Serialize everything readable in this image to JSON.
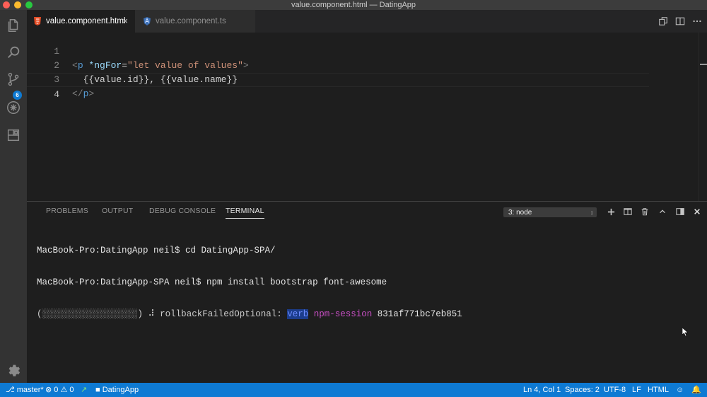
{
  "window": {
    "title": "value.component.html — DatingApp"
  },
  "activity": {
    "scm_badge": "6"
  },
  "tabs": [
    {
      "label": "value.component.html",
      "close": "×"
    },
    {
      "label": "value.component.ts"
    }
  ],
  "editor": {
    "line_numbers": [
      "1",
      "2",
      "3",
      "4"
    ],
    "lines": {
      "l1_open": "<",
      "l1_tag": "p",
      "l1_attr": " *ngFor",
      "l1_eq": "=",
      "l1_str": "\"let value of values\"",
      "l1_close": ">",
      "l2_text": "  {{value.id}}, {{value.name}}",
      "l3_open": "</",
      "l3_tag": "p",
      "l3_close": ">"
    }
  },
  "panel": {
    "tabs": [
      "PROBLEMS",
      "OUTPUT",
      "DEBUG CONSOLE",
      "TERMINAL"
    ],
    "terminal_select": "3: node",
    "terminal_lines": {
      "line1": "MacBook-Pro:DatingApp neil$ cd DatingApp-SPA/",
      "line2": "MacBook-Pro:DatingApp-SPA neil$ npm install bootstrap font-awesome",
      "progress": "(░░░░░░░░░░░░░░░░░░) ⠼ rollbackFailedOptional: ",
      "verb": "verb",
      "npm_session": " npm-session",
      "session_id": " 831af771bc7eb851"
    }
  },
  "statusbar": {
    "branch": "master*",
    "errors": "0",
    "warnings": "0",
    "folder": "DatingApp",
    "position": "Ln 4, Col 1",
    "spaces": "Spaces: 2",
    "encoding": "UTF-8",
    "eol": "LF",
    "language": "HTML"
  },
  "colors": {
    "statusbar": "#0e7ad3",
    "activitybar": "#333333",
    "editor_bg": "#1e1e1e"
  }
}
